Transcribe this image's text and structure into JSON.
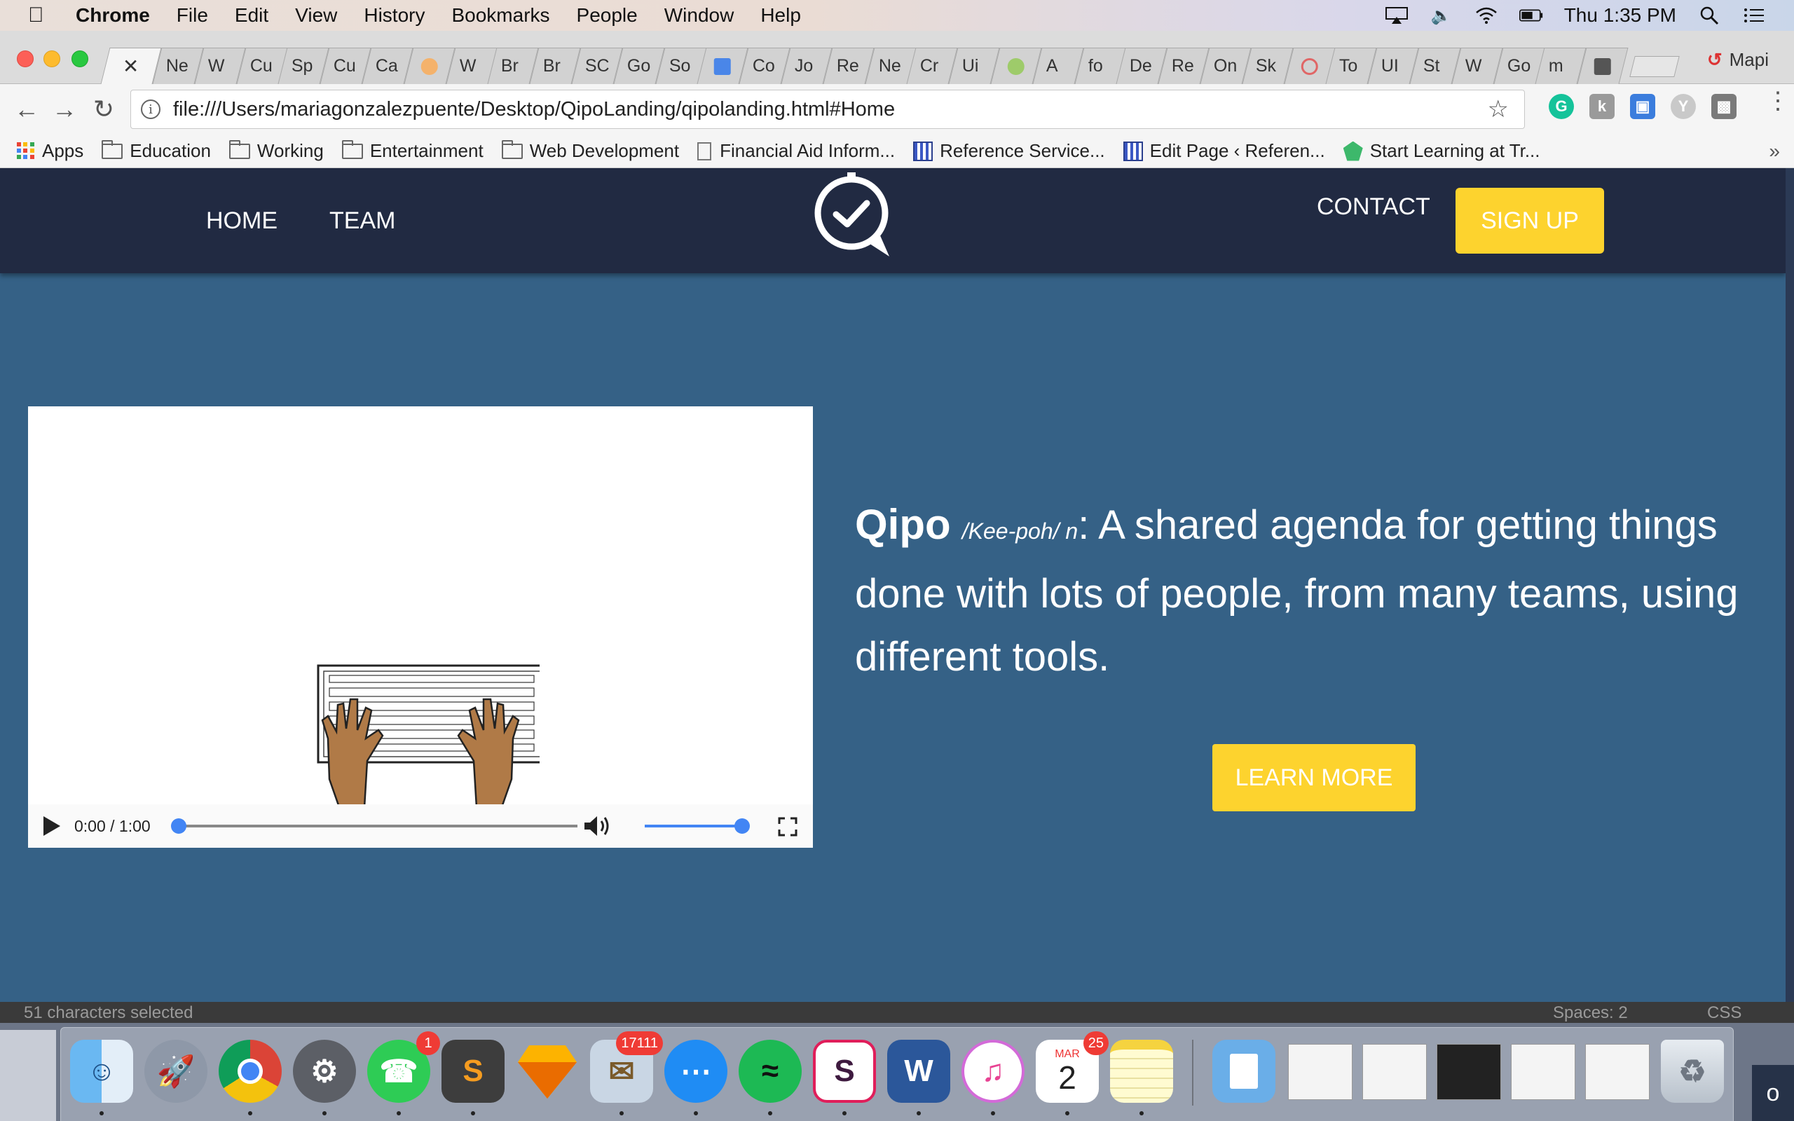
{
  "menubar": {
    "app": "Chrome",
    "items": [
      "File",
      "Edit",
      "View",
      "History",
      "Bookmarks",
      "People",
      "Window",
      "Help"
    ],
    "clock": "Thu 1:35 PM",
    "icons": [
      "airplay-icon",
      "volume-icon",
      "wifi-icon",
      "battery-icon",
      "spotlight-icon",
      "notification-center-icon"
    ]
  },
  "tabs": {
    "labels": [
      "",
      "Ne",
      "W",
      "Cu",
      "Sp",
      "Cu",
      "Ca",
      "",
      "W",
      "Br",
      "Br",
      "SC",
      "Go",
      "So",
      "",
      "Co",
      "Jo",
      "Re",
      "Ne",
      "Cr",
      "Ui",
      "",
      "A",
      "fo",
      "De",
      "Re",
      "On",
      "Sk",
      "",
      "To",
      "UI",
      "St",
      "W",
      "Go",
      "m",
      ""
    ],
    "profile": "Mapi"
  },
  "toolbar": {
    "url": "file:///Users/mariagonzalezpuente/Desktop/QipoLanding/qipolanding.html#Home"
  },
  "bookmarks": {
    "apps": "Apps",
    "education": "Education",
    "working": "Working",
    "entertainment": "Entertainment",
    "webdev": "Web Development",
    "financial": "Financial Aid Inform...",
    "reference": "Reference Service...",
    "editpage": "Edit Page ‹ Referen...",
    "startlearning": "Start Learning at Tr..."
  },
  "site": {
    "nav_home": "HOME",
    "nav_team": "TEAM",
    "nav_contact": "CONTACT",
    "signup": "SIGN UP",
    "hero_brand": "Qipo",
    "hero_pron": "/Kee-poh/ n",
    "hero_text": ": A shared agenda for getting things done with lots of people, from many teams, using different tools.",
    "learn_more": "LEARN MORE",
    "colors": {
      "nav_bg": "#212a42",
      "page_bg": "#356186",
      "button": "#fdd32e"
    }
  },
  "video": {
    "time": "0:00 / 1:00",
    "progress": 0,
    "volume": 1
  },
  "editor_status": {
    "selection": "51 characters selected",
    "spaces": "Spaces: 2",
    "syntax": "CSS"
  },
  "dock": {
    "whatsapp_badge": "1",
    "mail_badge": "17111",
    "calendar_month": "MAR",
    "calendar_day": "2",
    "calendar_badge": "25",
    "right_edge_text": "o"
  }
}
